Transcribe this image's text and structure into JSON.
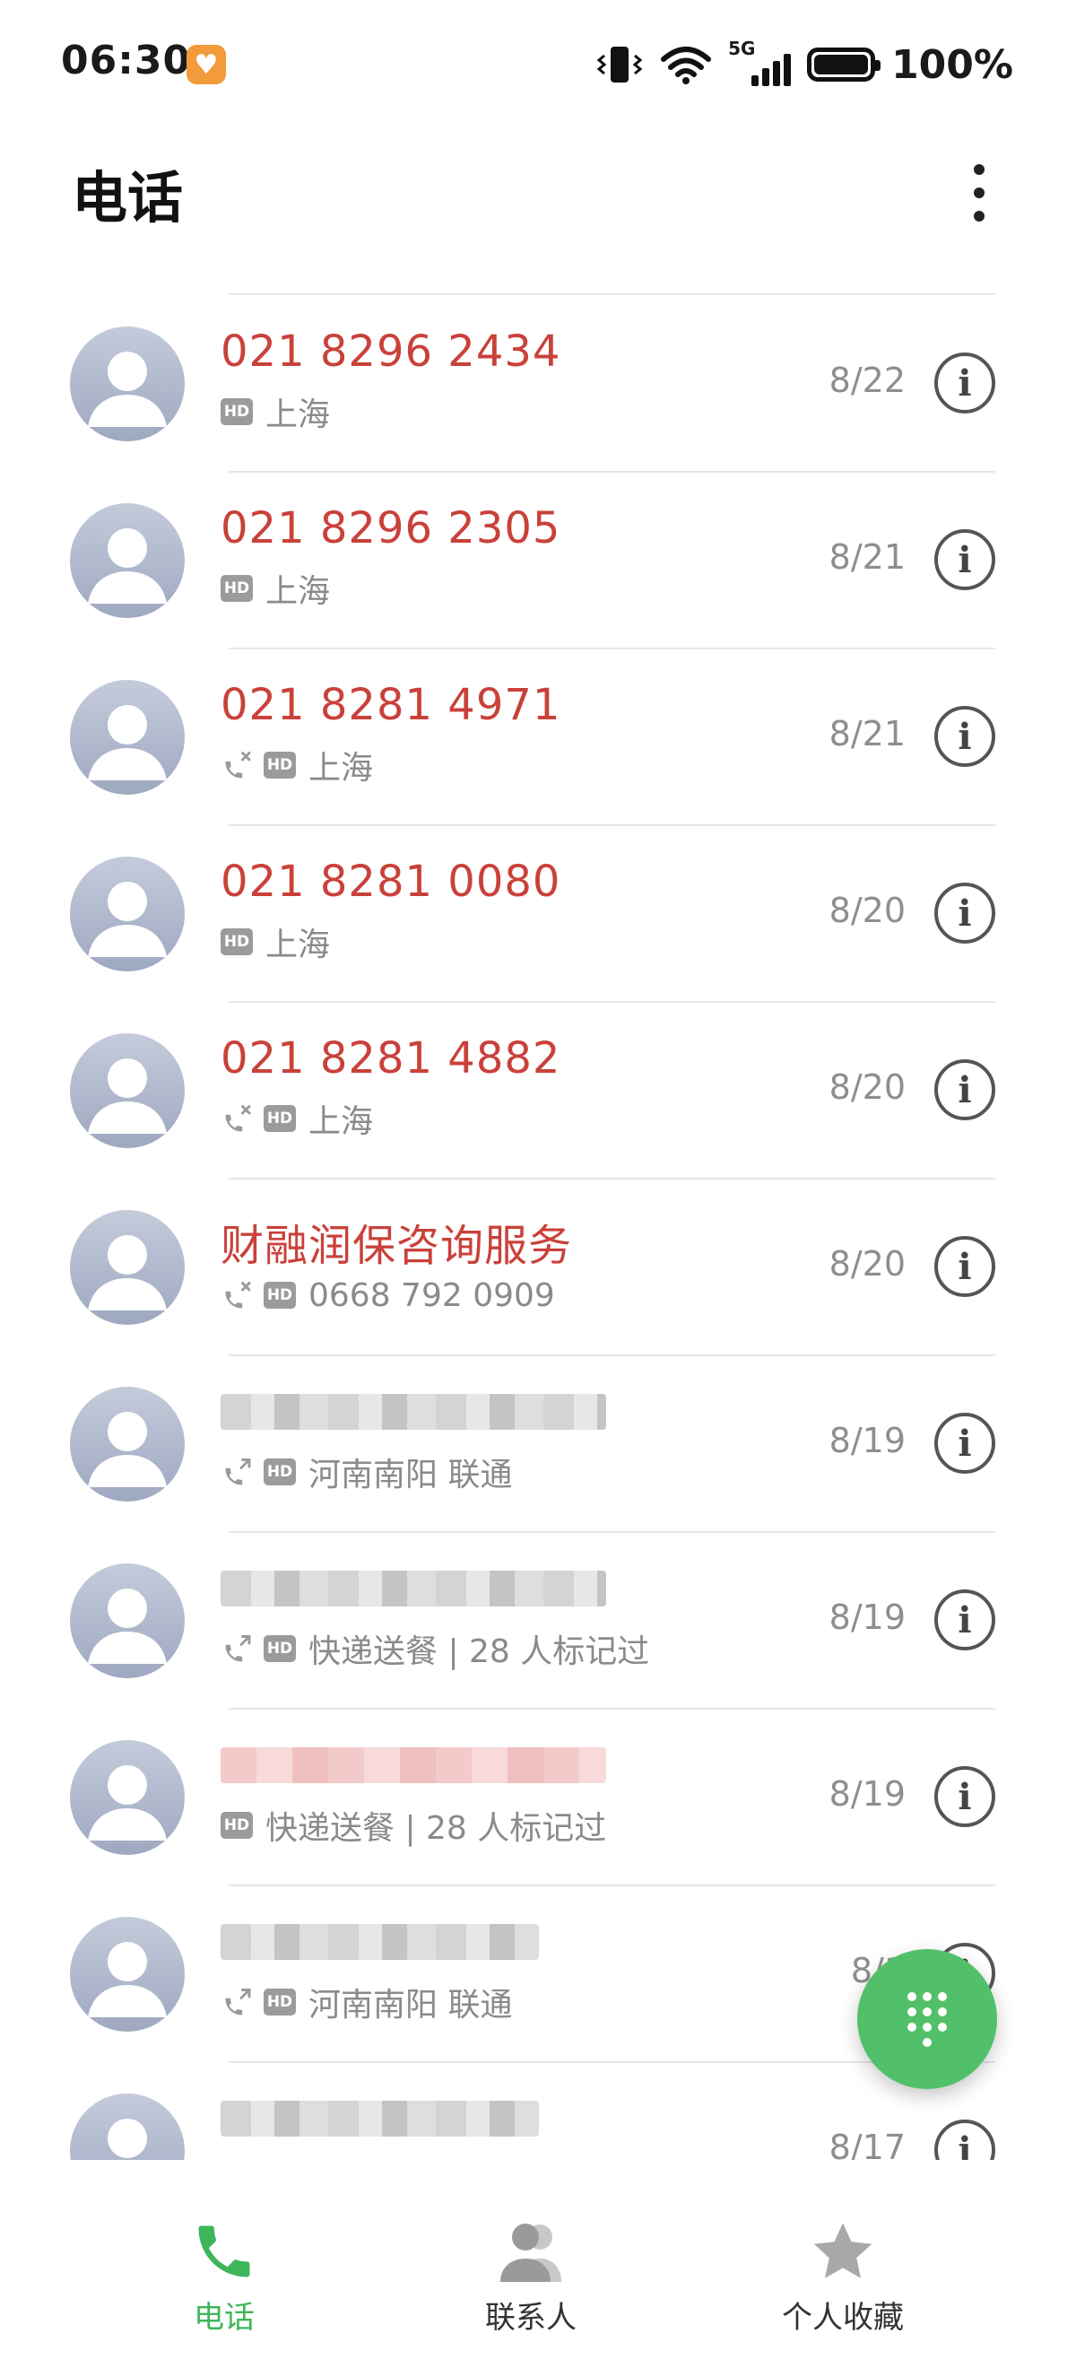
{
  "status_bar": {
    "time": "06:30",
    "network": "5G",
    "battery": "100%"
  },
  "header": {
    "title": "电话",
    "more_icon": "more-vertical-icon"
  },
  "calls": [
    {
      "name": "021 8296 2434",
      "name_color": "#c9413a",
      "type_icon": "",
      "hd": "HD",
      "detail": "上海",
      "date": "8/22"
    },
    {
      "name": "021 8296 2305",
      "name_color": "#c9413a",
      "type_icon": "",
      "hd": "HD",
      "detail": "上海",
      "date": "8/21"
    },
    {
      "name": "021 8281 4971",
      "name_color": "#c9413a",
      "type_icon": "missed-call-icon",
      "hd": "HD",
      "detail": "上海",
      "date": "8/21"
    },
    {
      "name": "021 8281 0080",
      "name_color": "#c9413a",
      "type_icon": "",
      "hd": "HD",
      "detail": "上海",
      "date": "8/20"
    },
    {
      "name": "021 8281 4882",
      "name_color": "#c9413a",
      "type_icon": "missed-call-icon",
      "hd": "HD",
      "detail": "上海",
      "date": "8/20"
    },
    {
      "name": "财融润保咨询服务",
      "name_color": "#c9413a",
      "type_icon": "missed-call-icon",
      "hd": "HD",
      "detail": "0668 792 0909",
      "date": "8/20"
    },
    {
      "name": "",
      "name_color": "#1a1a1a",
      "type_icon": "outgoing-call-icon",
      "hd": "HD",
      "detail": "河南南阳 联通",
      "date": "8/19",
      "redacted": true
    },
    {
      "name": "",
      "name_color": "#1a1a1a",
      "type_icon": "outgoing-call-icon",
      "hd": "HD",
      "detail": "快递送餐 | 28 人标记过",
      "date": "8/19",
      "redacted": true
    },
    {
      "name": "",
      "name_color": "#c9413a",
      "type_icon": "",
      "hd": "HD",
      "detail": "快递送餐 | 28 人标记过",
      "date": "8/19",
      "redacted": true
    },
    {
      "name": "",
      "name_color": "#1a1a1a",
      "type_icon": "outgoing-call-icon",
      "hd": "HD",
      "detail": "河南南阳 联通",
      "date": "8/1",
      "redacted": true
    },
    {
      "name": "",
      "name_color": "#1a1a1a",
      "type_icon": "",
      "hd": "",
      "detail": "",
      "date": "8/17",
      "redacted": true
    }
  ],
  "fab": {
    "icon": "dialpad-icon"
  },
  "bottom_nav": [
    {
      "label": "电话",
      "icon": "phone-icon",
      "active": true
    },
    {
      "label": "联系人",
      "icon": "contacts-icon",
      "active": false
    },
    {
      "label": "个人收藏",
      "icon": "star-icon",
      "active": false
    }
  ],
  "colors": {
    "missed": "#c9413a",
    "accent_green": "#52c06a",
    "nav_active": "#3fb55a"
  }
}
